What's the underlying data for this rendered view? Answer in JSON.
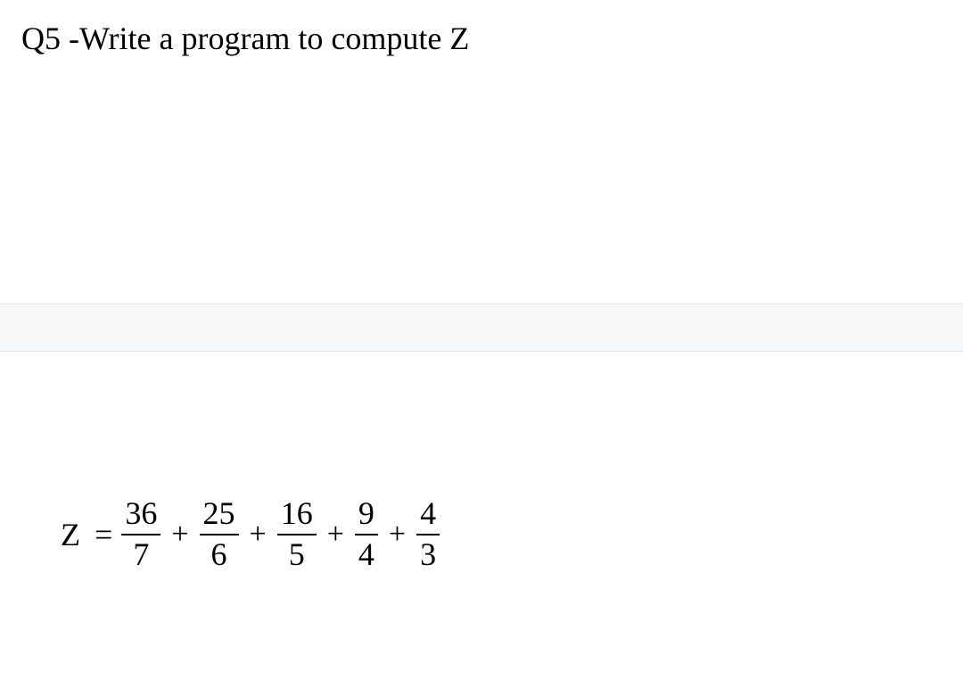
{
  "question": {
    "label": "Q5 -Write a program to compute Z"
  },
  "equation": {
    "variable": "Z",
    "equals": "=",
    "plus": "+",
    "terms": [
      {
        "numerator": "36",
        "denominator": "7"
      },
      {
        "numerator": "25",
        "denominator": "6"
      },
      {
        "numerator": "16",
        "denominator": "5"
      },
      {
        "numerator": "9",
        "denominator": "4"
      },
      {
        "numerator": "4",
        "denominator": "3"
      }
    ]
  }
}
